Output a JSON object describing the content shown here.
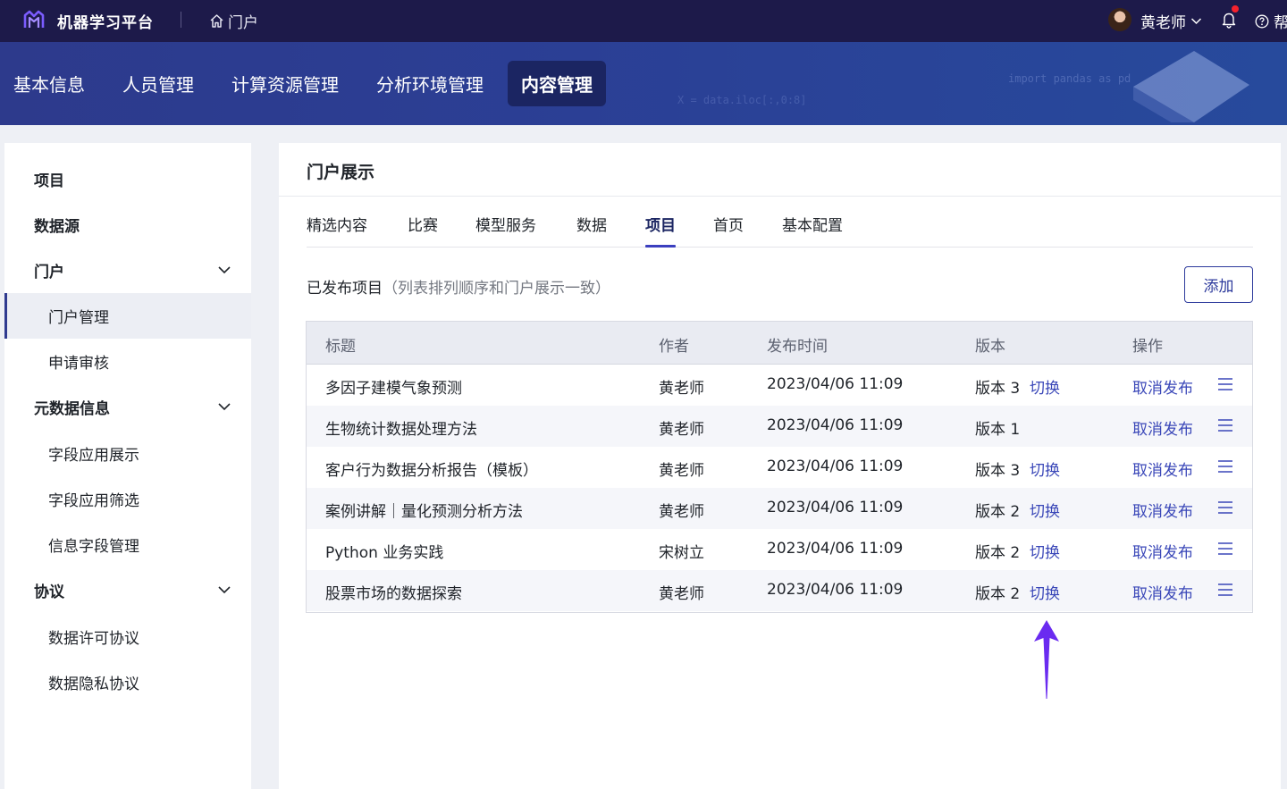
{
  "topbar": {
    "app_title": "机器学习平台",
    "portal_link": "门户",
    "user_name": "黄老师",
    "help_label": "帮助"
  },
  "nav": {
    "items": [
      "基本信息",
      "人员管理",
      "计算资源管理",
      "分析环境管理",
      "内容管理"
    ],
    "active_index": 4,
    "decor_code_1": "import pandas as pd",
    "decor_code_2": "X = data.iloc[:,0:8]"
  },
  "sidebar": {
    "items": [
      {
        "label": "项目",
        "level": 1
      },
      {
        "label": "数据源",
        "level": 1
      },
      {
        "label": "门户",
        "level": 1,
        "expandable": true
      },
      {
        "label": "门户管理",
        "level": 2,
        "active": true
      },
      {
        "label": "申请审核",
        "level": 2
      },
      {
        "label": "元数据信息",
        "level": 1,
        "expandable": true
      },
      {
        "label": "字段应用展示",
        "level": 2
      },
      {
        "label": "字段应用筛选",
        "level": 2
      },
      {
        "label": "信息字段管理",
        "level": 2
      },
      {
        "label": "协议",
        "level": 1,
        "expandable": true
      },
      {
        "label": "数据许可协议",
        "level": 2
      },
      {
        "label": "数据隐私协议",
        "level": 2
      }
    ]
  },
  "main": {
    "title": "门户展示",
    "tabs": [
      "精选内容",
      "比赛",
      "模型服务",
      "数据",
      "项目",
      "首页",
      "基本配置"
    ],
    "active_tab": "项目",
    "section_title": "已发布项目",
    "section_note": "（列表排列顺序和门户展示一致）",
    "add_button": "添加",
    "table": {
      "columns": [
        "标题",
        "作者",
        "发布时间",
        "版本",
        "操作"
      ],
      "rows": [
        {
          "title": "多因子建模气象预测",
          "author": "黄老师",
          "time": "2023/04/06 11:09",
          "version": "版本 3",
          "switch": "切换",
          "action": "取消发布"
        },
        {
          "title": "生物统计数据处理方法",
          "author": "黄老师",
          "time": "2023/04/06 11:09",
          "version": "版本 1",
          "switch": "",
          "action": "取消发布"
        },
        {
          "title": "客户行为数据分析报告（模板）",
          "author": "黄老师",
          "time": "2023/04/06 11:09",
          "version": "版本 3",
          "switch": "切换",
          "action": "取消发布"
        },
        {
          "title": "案例讲解｜量化预测分析方法",
          "author": "黄老师",
          "time": "2023/04/06 11:09",
          "version": "版本 2",
          "switch": "切换",
          "action": "取消发布"
        },
        {
          "title": "Python 业务实践",
          "author": "宋树立",
          "time": "2023/04/06 11:09",
          "version": "版本 2",
          "switch": "切换",
          "action": "取消发布"
        },
        {
          "title": "股票市场的数据探索",
          "author": "黄老师",
          "time": "2023/04/06 11:09",
          "version": "版本 2",
          "switch": "切换",
          "action": "取消发布"
        }
      ]
    }
  },
  "icons": {
    "logo": "logo-icon",
    "portal": "home-icon",
    "user_menu": "chevron-down-icon",
    "notifications": "bell-icon",
    "help": "question-circle-icon",
    "row_menu": "menu-lines-icon",
    "annotation": "arrow-up-icon"
  },
  "colors": {
    "topbar_bg": "#1d1a4a",
    "nav_bg": "#2b3f95",
    "accent": "#3a47b8",
    "annotation_arrow": "#6a2bf0",
    "notification_dot": "#f5222d"
  }
}
